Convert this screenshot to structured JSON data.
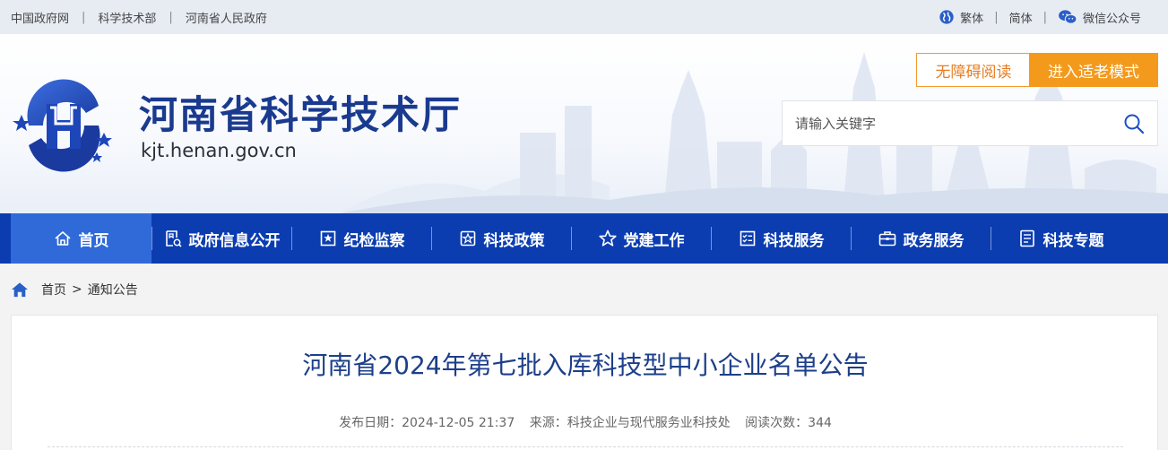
{
  "topbar": {
    "links": [
      "中国政府网",
      "科学技术部",
      "河南省人民政府"
    ],
    "traditional": "繁体",
    "simplified": "简体",
    "wechat": "微信公众号"
  },
  "header": {
    "title": "河南省科学技术厅",
    "url": "kjt.henan.gov.cn",
    "accessibility_label": "无障碍阅读",
    "elder_mode_label": "进入适老模式",
    "search_placeholder": "请输入关键字"
  },
  "nav": {
    "items": [
      "首页",
      "政府信息公开",
      "纪检监察",
      "科技政策",
      "党建工作",
      "科技服务",
      "政务服务",
      "科技专题"
    ]
  },
  "breadcrumb": {
    "home": "首页",
    "separator": ">",
    "current": "通知公告"
  },
  "article": {
    "title": "河南省2024年第七批入库科技型中小企业名单公告",
    "date": "发布日期：2024-12-05 21:37",
    "source": "来源：科技企业与现代服务业科技处",
    "views": "阅读次数：344"
  },
  "colors": {
    "brand_blue": "#0b3db1",
    "active_blue": "#2f6ad8",
    "orange": "#f39a1d",
    "title_blue": "#1a3a8f"
  }
}
